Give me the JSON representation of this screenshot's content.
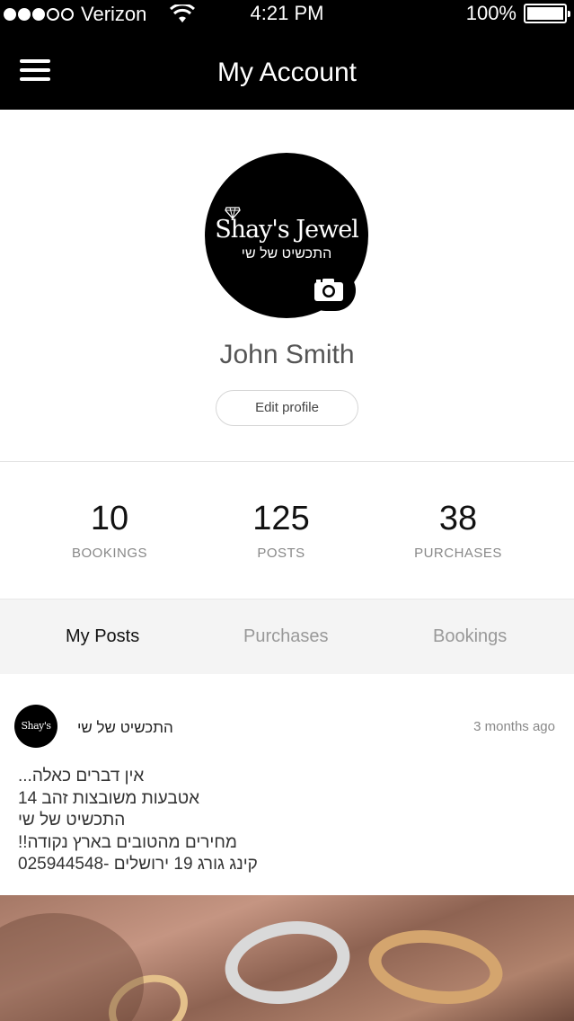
{
  "status_bar": {
    "carrier": "Verizon",
    "time": "4:21 PM",
    "battery": "100%",
    "signal_bars": 3,
    "signal_total": 5
  },
  "nav": {
    "title": "My Account",
    "menu_icon": "hamburger-menu-icon"
  },
  "profile": {
    "avatar_brand": "Shay's Jewel",
    "avatar_brand_hebrew": "התכשיט של שי",
    "camera_icon": "camera-icon",
    "name": "John Smith",
    "edit_label": "Edit profile"
  },
  "stats": [
    {
      "value": "10",
      "label": "BOOKINGS"
    },
    {
      "value": "125",
      "label": "POSTS"
    },
    {
      "value": "38",
      "label": "PURCHASES"
    }
  ],
  "tabs": [
    {
      "label": "My Posts",
      "active": true
    },
    {
      "label": "Purchases",
      "active": false
    },
    {
      "label": "Bookings",
      "active": false
    }
  ],
  "post": {
    "avatar_text": "Shay's Jewel",
    "author": "התכשיט של שי",
    "time": "3 months ago",
    "lines": [
      "אין דברים כאלה...",
      "אטבעות משובצות זהב 14",
      "התכשיט של שי",
      "מחירים מהטובים בארץ נקודה!!",
      "קינג גורג 19 ירושלים -025944548"
    ]
  },
  "colors": {
    "bar_background": "#000000",
    "tab_background": "#f4f4f4",
    "muted_text": "#888888"
  }
}
